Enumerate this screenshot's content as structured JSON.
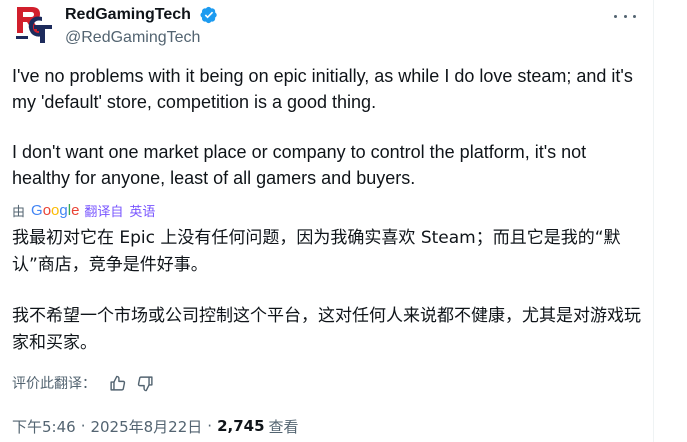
{
  "author": {
    "display_name": "RedGamingTech",
    "handle": "@RedGamingTech",
    "verified": true,
    "avatar_text": "RGT"
  },
  "tweet": {
    "paragraphs": [
      "I've no problems with it being on epic initially, as while I do love steam; and it's my 'default' store, competition is a good thing.",
      "I don't want one market place or company to control the platform, it's not healthy for anyone, least of all gamers and buyers."
    ]
  },
  "translation": {
    "by_label": "由",
    "provider": "Google",
    "translated_label": "翻译自",
    "language": "英语",
    "paragraphs": [
      "我最初对它在 Epic 上没有任何问题，因为我确实喜欢 Steam；而且它是我的“默认”商店，竞争是件好事。",
      "我不希望一个市场或公司控制这个平台，这对任何人来说都不健康，尤其是对游戏玩家和买家。"
    ],
    "rate_label": "评价此翻译："
  },
  "meta": {
    "time": "下午5:46",
    "date": "2025年8月22日",
    "views_count": "2,745",
    "views_label": "查看"
  },
  "colors": {
    "verified": "#1d9bf0",
    "secondary_text": "#536471",
    "translate_accent": "#7856ff",
    "avatar_red": "#d11f2c",
    "avatar_navy": "#1d2b5c"
  },
  "icons": [
    "more-icon",
    "verified-badge-icon",
    "thumbs-up-icon",
    "thumbs-down-icon"
  ]
}
